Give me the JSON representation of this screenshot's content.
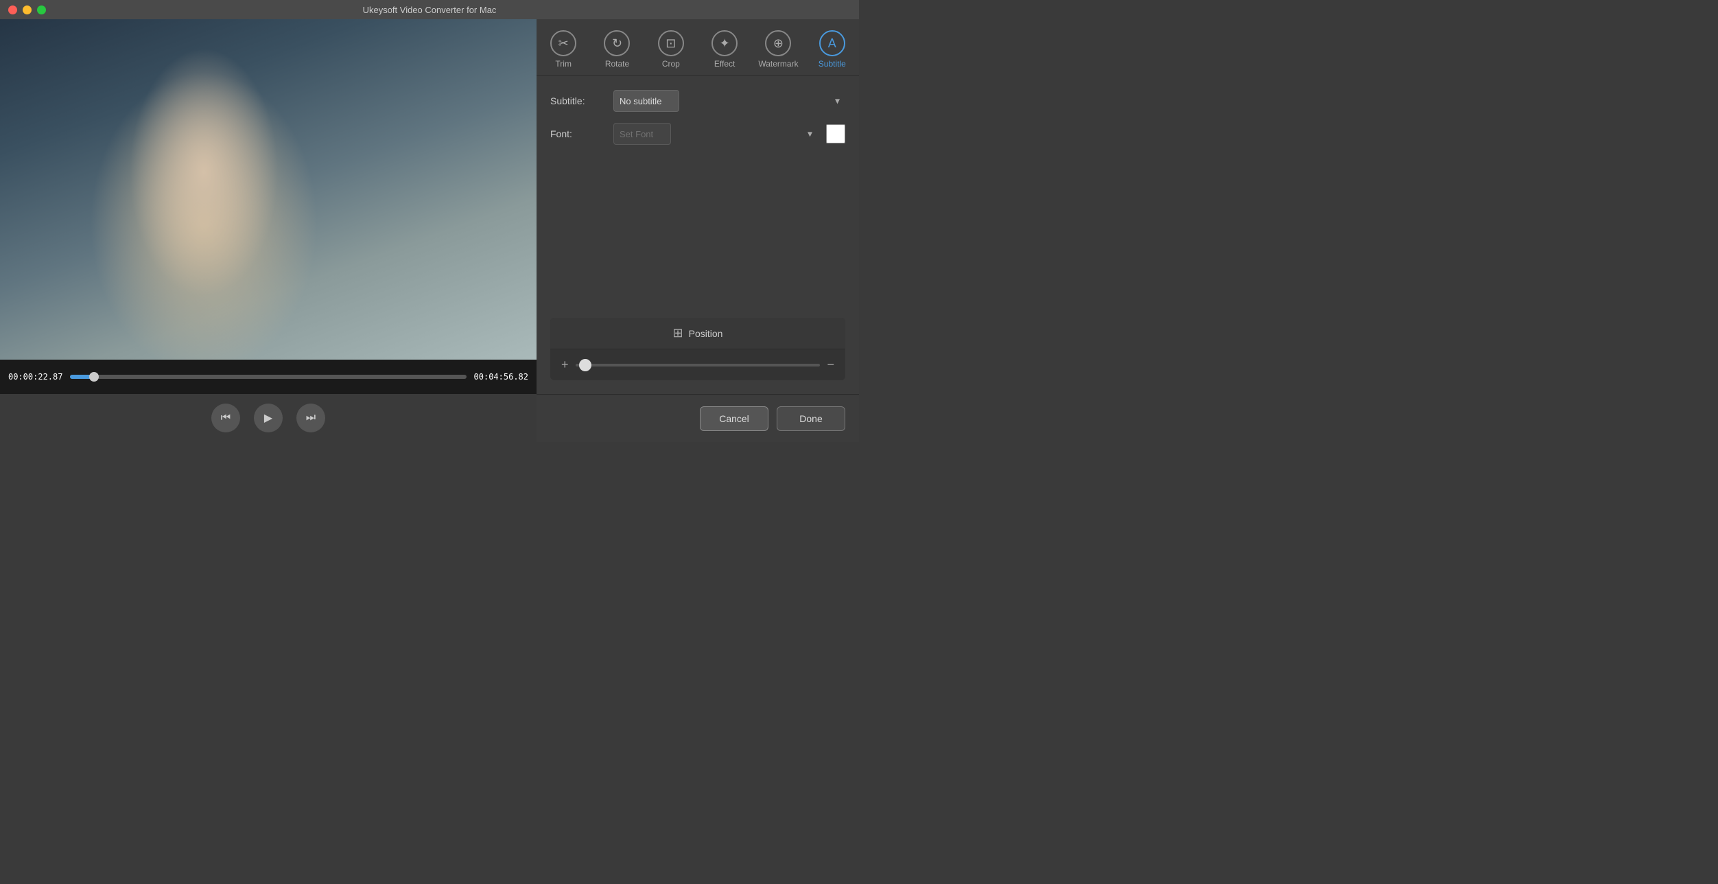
{
  "app": {
    "title": "Ukeysoft Video Converter for Mac"
  },
  "titlebar": {
    "close_label": "close",
    "minimize_label": "minimize",
    "maximize_label": "maximize"
  },
  "toolbar": {
    "tabs": [
      {
        "id": "trim",
        "label": "Trim",
        "icon": "✂"
      },
      {
        "id": "rotate",
        "label": "Rotate",
        "icon": "↻"
      },
      {
        "id": "crop",
        "label": "Crop",
        "icon": "⊡"
      },
      {
        "id": "effect",
        "label": "Effect",
        "icon": "✦"
      },
      {
        "id": "watermark",
        "label": "Watermark",
        "icon": "⊕"
      },
      {
        "id": "subtitle",
        "label": "Subtitle",
        "icon": "A",
        "active": true
      }
    ]
  },
  "video": {
    "current_time": "00:00:22.87",
    "total_time": "00:04:56.82",
    "progress_percent": 6
  },
  "controls": {
    "prev_icon": "⏮",
    "play_icon": "▶",
    "next_icon": "⏭"
  },
  "subtitle_settings": {
    "subtitle_label": "Subtitle:",
    "font_label": "Font:",
    "subtitle_value": "No subtitle",
    "font_placeholder": "Set Font",
    "subtitle_options": [
      "No subtitle"
    ],
    "font_options": [
      "Set Font"
    ]
  },
  "position": {
    "label": "Position",
    "plus_label": "+",
    "minus_label": "−"
  },
  "bottom": {
    "cancel_label": "Cancel",
    "done_label": "Done"
  }
}
